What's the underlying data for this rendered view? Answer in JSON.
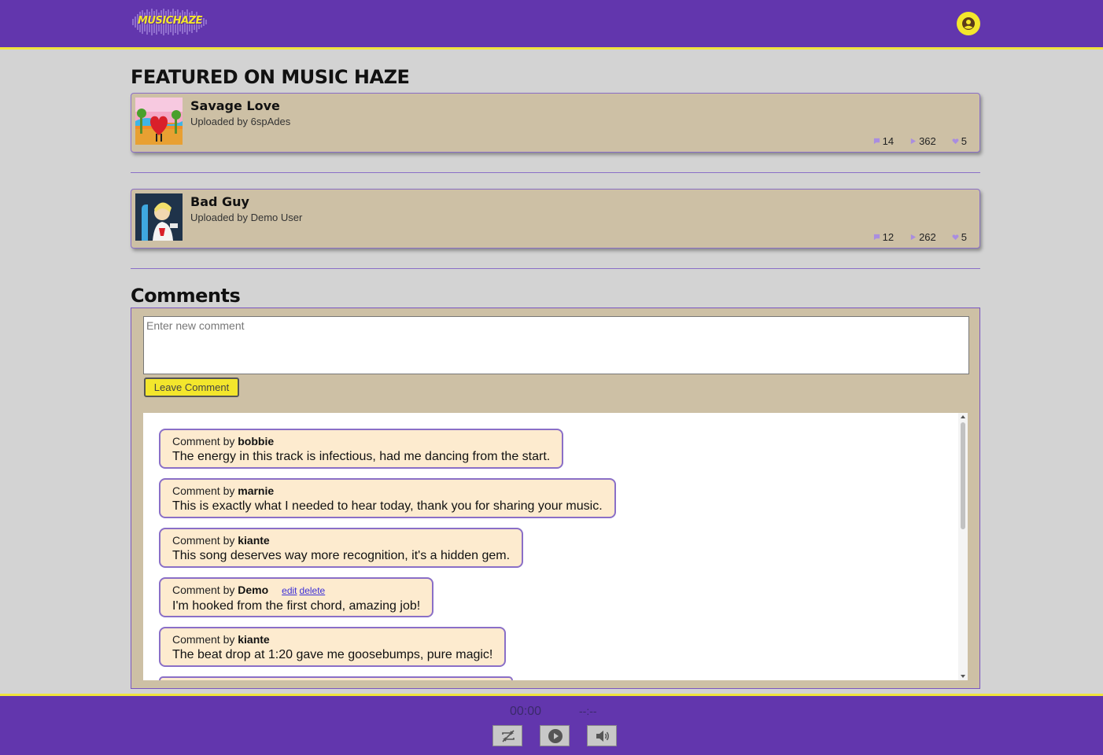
{
  "header": {
    "logo_text": "MUSICHAZE",
    "user_icon": "user-circle-icon",
    "colors": {
      "bar": "#6236ad",
      "accent": "#f3e62c"
    }
  },
  "featured": {
    "title": "FEATURED ON MUSIC HAZE",
    "songs": [
      {
        "title": "Savage Love",
        "uploader": "Uploaded by 6spAdes",
        "comments": "14",
        "plays": "362",
        "likes": "5"
      },
      {
        "title": "Bad Guy",
        "uploader": "Uploaded by Demo User",
        "comments": "12",
        "plays": "262",
        "likes": "5"
      }
    ]
  },
  "comments": {
    "title": "Comments",
    "input_placeholder": "Enter new comment",
    "submit_label": "Leave Comment",
    "edit_label": "edit",
    "delete_label": "delete",
    "items": [
      {
        "prefix": "Comment by",
        "author": "bobbie",
        "text": "The energy in this track is infectious, had me dancing from the start."
      },
      {
        "prefix": "Comment by",
        "author": "marnie",
        "text": "This is exactly what I needed to hear today, thank you for sharing your music."
      },
      {
        "prefix": "Comment by",
        "author": "kiante",
        "text": "This song deserves way more recognition, it's a hidden gem."
      },
      {
        "prefix": "Comment by",
        "author": "Demo",
        "text": "I'm hooked from the first chord, amazing job!",
        "own": true
      },
      {
        "prefix": "Comment by",
        "author": "kiante",
        "text": "The beat drop at 1:20 gave me goosebumps, pure magic!"
      }
    ]
  },
  "player": {
    "current_time": "00:00",
    "total_time": "--:--",
    "buttons": [
      "loop-icon",
      "play-icon",
      "volume-icon"
    ]
  }
}
